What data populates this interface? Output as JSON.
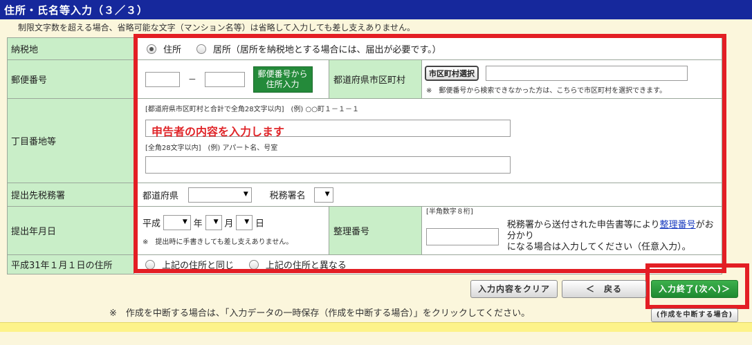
{
  "header": {
    "title": "住所・氏名等入力（３／３）"
  },
  "top_note": "制限文字数を超える場合、省略可能な文字（マンション名等）は省略して入力しても差し支えありません。",
  "tax_place": {
    "label": "納税地",
    "option_address": "住所",
    "option_residence": "居所（居所を納税地とする場合には、届出が必要です。）"
  },
  "postal": {
    "label": "郵便番号",
    "dash": "－",
    "lookup_button_line1": "郵便番号から",
    "lookup_button_line2": "住所入力",
    "pref_city_label": "都道府県市区町村",
    "city_select_button": "市区町村選択",
    "hint": "※　郵便番号から検索できなかった方は、こちらで市区町村を選択できます。"
  },
  "address": {
    "label": "丁目番地等",
    "line1_hint": "[都道府県市区町村と合計で全角28文字以内]　(例) ○○町１－１－１",
    "overlay_text": "申告者の内容を入力します",
    "line2_hint": "[全角28文字以内]　(例) アパート名、号室"
  },
  "tax_office": {
    "label": "提出先税務署",
    "pref_label": "都道府県",
    "office_label": "税務署名"
  },
  "submit_date": {
    "label": "提出年月日",
    "era": "平成",
    "year_unit": "年",
    "month_unit": "月",
    "day_unit": "日",
    "note": "※　提出時に手書きしても差し支えありません。",
    "ref_label": "整理番号",
    "ref_hint": "[半角数字８桁]",
    "ref_desc_before": "税務署から送付された申告書等により",
    "ref_desc_link": "整理番号",
    "ref_desc_after": "がお分かり",
    "ref_desc_line2": "になる場合は入力してください（任意入力）。"
  },
  "h31_address": {
    "label": "平成31年１月１日の住所",
    "option_same": "上記の住所と同じ",
    "option_diff": "上記の住所と異なる"
  },
  "buttons": {
    "clear": "入力内容をクリア",
    "back": "＜　戻る",
    "next": "入力終了(次へ)＞",
    "suspend": "(作成を中断する場合)"
  },
  "bottom_note": "※　作成を中断する場合は、「入力データの一時保存（作成を中断する場合）」をクリックしてください。",
  "colors": {
    "title_bg": "#16289c",
    "label_bg": "#c9eec8",
    "highlight_red": "#e31e24",
    "green_button": "#248a3a"
  }
}
